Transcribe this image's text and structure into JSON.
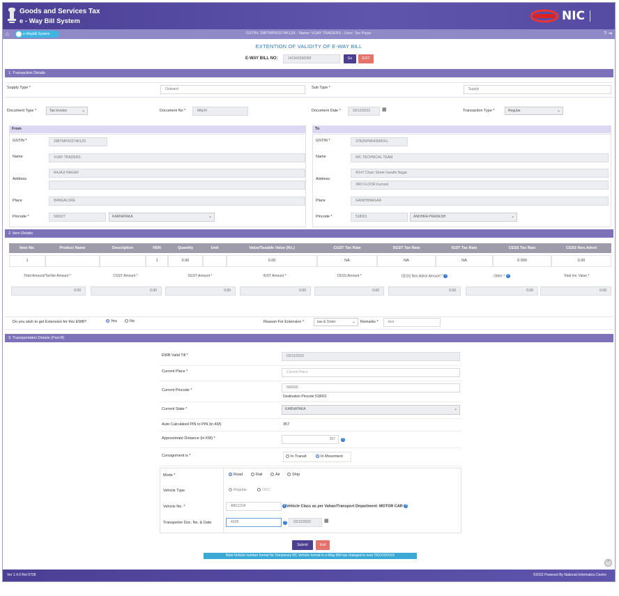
{
  "header": {
    "title_line1": "Goods and Services Tax",
    "title_line2": "e - Way Bill System",
    "logo_text": "NIC",
    "brand_color": "#4b3f95"
  },
  "subbar": {
    "pill_label": "e-Waybill System",
    "info": "GSTIN: 29BTMPK0274K1ZK - Name: VIJAY TRADERS - User: Tax Payer",
    "icons": [
      "help-icon",
      "logout-icon"
    ]
  },
  "page_title": "EXTENTION OF VALIDITY OF E-WAY BILL",
  "ewb": {
    "label": "E-WAY BILL NO:",
    "value": "141943268389",
    "go_label": "Go",
    "exit_label": "EXIT"
  },
  "section1": {
    "title": "1. Transaction Details",
    "supply_type_label": "Supply Type *",
    "supply_type_value": "Outward",
    "sub_type_label": "Sub Type *",
    "sub_type_value": "Supply",
    "doc_type_label": "Document Type *",
    "doc_type_value": "Tax Invoice",
    "doc_no_label": "Document No *",
    "doc_no_value": "Mfg34",
    "doc_date_label": "Document Date *",
    "doc_date_value": "03/12/2022",
    "trans_type_label": "Transaction Type *",
    "trans_type_value": "Regular",
    "from": {
      "title": "From",
      "gstin_label": "GSTIN *",
      "gstin": "29BTMPK0274K1ZK",
      "name_label": "Name",
      "name": "VIJAY TRADERS",
      "address_label": "Address",
      "address1": "RAJAJI NAGAR",
      "address2": "",
      "place_label": "Place",
      "place": "BANGALORE",
      "pincode_label": "Pincode *",
      "pincode": "560027",
      "state": "KARNATAKA"
    },
    "to": {
      "title": "To",
      "gstin_label": "GSTIN *",
      "gstin": "37BZNPM9430M1KL",
      "name_label": "Name",
      "name": "NIC TECHNICAL TEAM",
      "address_label": "Address",
      "address1": "4/147 Chain Street Gandhi Nagar",
      "address2": "3RD FLOOR Kurnool",
      "place_label": "Place",
      "place": "GANDHINAGAR",
      "pincode_label": "Pincode *",
      "pincode": "518001",
      "state": "ANDHRA PRADESH"
    }
  },
  "section2": {
    "title": "2. Item Details",
    "columns": [
      "Item No.",
      "Product Name",
      "Description",
      "HSN",
      "Quantity",
      "Unit",
      "Value/Taxable Value (Rs.)",
      "CGST Tax Rate",
      "SGST Tax Rate",
      "IGST Tax Rate",
      "CESS Tax Rate",
      "CESS Non.Advol"
    ],
    "row": [
      "1",
      "",
      "",
      "1",
      "0.00",
      "",
      "0.00",
      "NA",
      "NA",
      "NA",
      "0.000",
      "0.00"
    ],
    "totals_labels": [
      "Total Amount/Tax'ble Amount *",
      "CGST Amount *",
      "SGST Amount *",
      "IGST Amount *",
      "CESS Amount *",
      "CESS Non Advol Amount *",
      "Other *",
      "Total Inv. Value *"
    ],
    "totals_values": [
      "0.00",
      "0.00",
      "0.00",
      "0.00",
      "0.00",
      "0.00",
      "0.00",
      "0.00"
    ]
  },
  "extension": {
    "question": "Do you wish to get Extension for this EWB?",
    "yes": "Yes",
    "no": "No",
    "selected": "Yes",
    "reason_label": "Reason For Extension *",
    "reason_value": "law & Order",
    "remarks_label": "Remarks *",
    "remarks_value": "test"
  },
  "section3": {
    "title": "3. Transportation Details (Part-B)",
    "valid_till_label": "EWB Valid Till *",
    "valid_till": "03/12/2022",
    "current_place_label": "Current Place *",
    "current_place_placeholder": "Current Place",
    "current_pincode_label": "Current Pincode *",
    "current_pincode": "560090",
    "destination_pincode": "Destination Pincode 518001",
    "current_state_label": "Current State *",
    "current_state": "KARNATAKA",
    "auto_distance_label": "Auto Calculated PIN to PIN (in KM)",
    "auto_distance": "357",
    "approx_distance_label": "Approximate Distance (in KM) *",
    "approx_distance": "357",
    "consignment_label": "Consignment is *",
    "in_transit": "In Transit",
    "in_movement": "In Movement",
    "mode_label": "Mode *",
    "modes": [
      "Road",
      "Rail",
      "Air",
      "Ship"
    ],
    "vehicle_type_label": "Vehicle Type",
    "vehicle_types": [
      "Regular",
      "ODC"
    ],
    "vehicle_no_label": "Vehicle No. *",
    "vehicle_no": "ABC1234",
    "vehicle_class": "Vehicle Class as per Vahan/Transport Department: MOTOR CAR",
    "transporter_doc_label": "Transporter Doc. No. & Date",
    "transporter_doc": "4328",
    "transporter_date": "03/12/2022"
  },
  "actions": {
    "submit": "Submit",
    "exit": "Exit",
    "note": "Note:Vehicle number format for Temporary RC Vehicle format in e-Way Bill has changed to now TRXXXXXXX"
  },
  "footer": {
    "version": "Ver 1.4.0 Rel 0728",
    "copyright": "©2022 Powered By National Informatics Centre"
  }
}
